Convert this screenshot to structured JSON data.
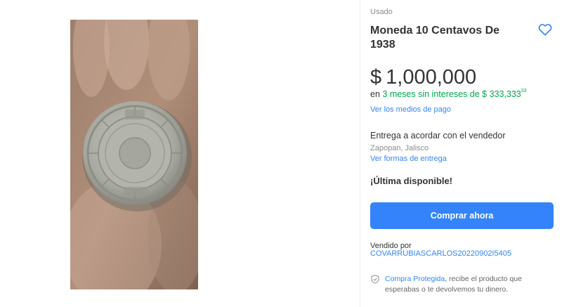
{
  "listing": {
    "condition": "Usado",
    "title": "Moneda 10 Centavos De 1938",
    "price": {
      "symbol": "$",
      "amount": "1,000,000"
    },
    "installments": {
      "prefix": "en",
      "plan": "3 meses sin intereses de",
      "amount": "$ 333,333",
      "cents": "33"
    },
    "payment_link": "Ver los medios de pago",
    "delivery": {
      "text": "Entrega a acordar con el vendedor",
      "location": "Zapopan, Jalisco",
      "link": "Ver formas de entrega"
    },
    "stock": "¡Última disponible!",
    "buy_button": "Comprar ahora",
    "seller": {
      "label": "Vendido por",
      "name": "COVARRUBIASCARLOS20220902I5405"
    },
    "protection": {
      "link": "Compra Protegida",
      "text": ", recibe el producto que esperabas o te devolvemos tu dinero."
    }
  },
  "icons": {
    "favorite": "heart-icon",
    "protection": "shield-icon"
  },
  "colors": {
    "accent": "#3483fa",
    "green": "#00a650",
    "muted": "#8c8c8c",
    "text": "#333333"
  }
}
